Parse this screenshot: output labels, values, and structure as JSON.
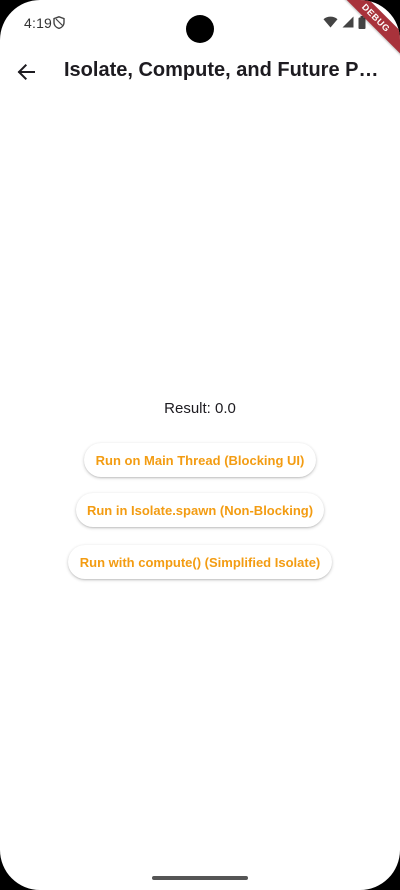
{
  "status_bar": {
    "time": "4:19",
    "icons": [
      "shield-icon",
      "wifi-icon",
      "signal-icon",
      "battery-icon"
    ],
    "debug_banner": "DEBUG",
    "debug_color": "#a8323b"
  },
  "app_bar": {
    "back_icon": "arrow-left-icon",
    "title": "Isolate, Compute, and Future Processing"
  },
  "main": {
    "result_label": "Result: 0.0",
    "buttons": [
      {
        "label": "Run on Main Thread (Blocking UI)"
      },
      {
        "label": "Run in Isolate.spawn (Non-Blocking)"
      },
      {
        "label": "Run with compute() (Simplified Isolate)"
      }
    ],
    "accent_color": "#f39c12"
  }
}
